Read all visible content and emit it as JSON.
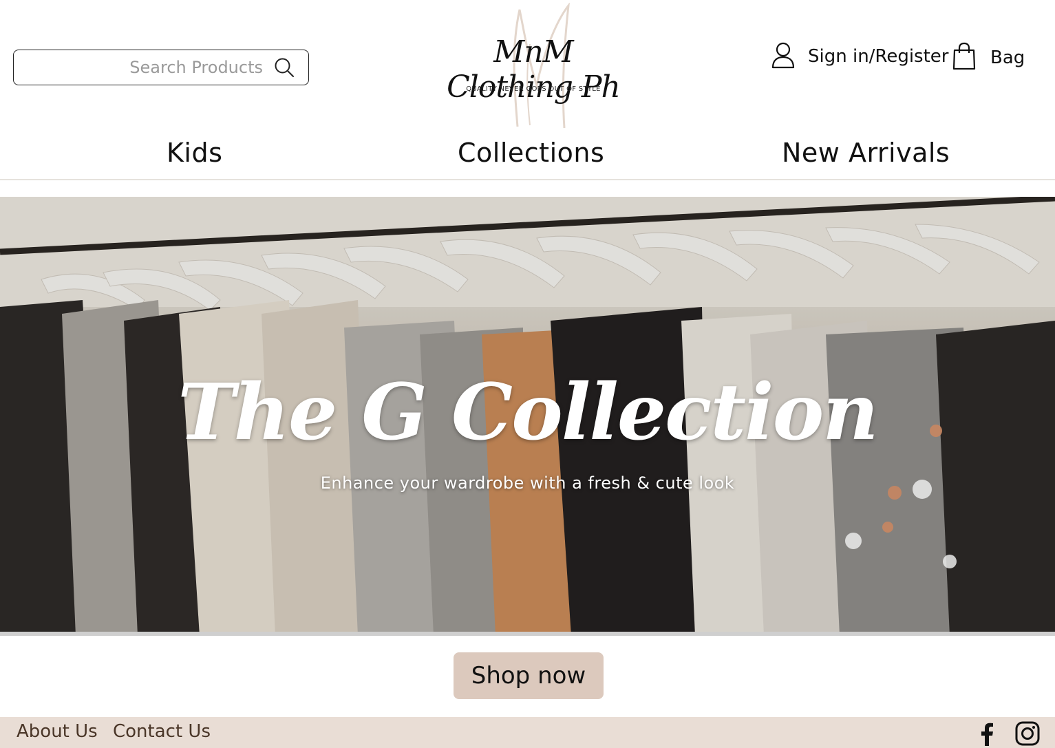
{
  "header": {
    "search": {
      "placeholder": "Search Products",
      "value": ""
    },
    "logo": {
      "name": "MnM Clothing Ph",
      "tagline": "QUALITY NEVER GOES OUT OF STYLE"
    },
    "account_label": "Sign in/Register",
    "bag_label": "Bag"
  },
  "nav": {
    "items": [
      {
        "label": "Kids"
      },
      {
        "label": "Collections"
      },
      {
        "label": "New Arrivals"
      }
    ]
  },
  "hero": {
    "title": "The G Collection",
    "subtitle": "Enhance your wardrobe with a fresh & cute look"
  },
  "cta": {
    "label": "Shop now",
    "color": "#dcc9bd"
  },
  "footer": {
    "links": [
      {
        "label": "About Us"
      },
      {
        "label": "Contact Us"
      }
    ],
    "social": [
      {
        "icon": "facebook-icon"
      },
      {
        "icon": "instagram-icon"
      }
    ],
    "background": "#e9ddd5",
    "text_color": "#4a3628"
  }
}
